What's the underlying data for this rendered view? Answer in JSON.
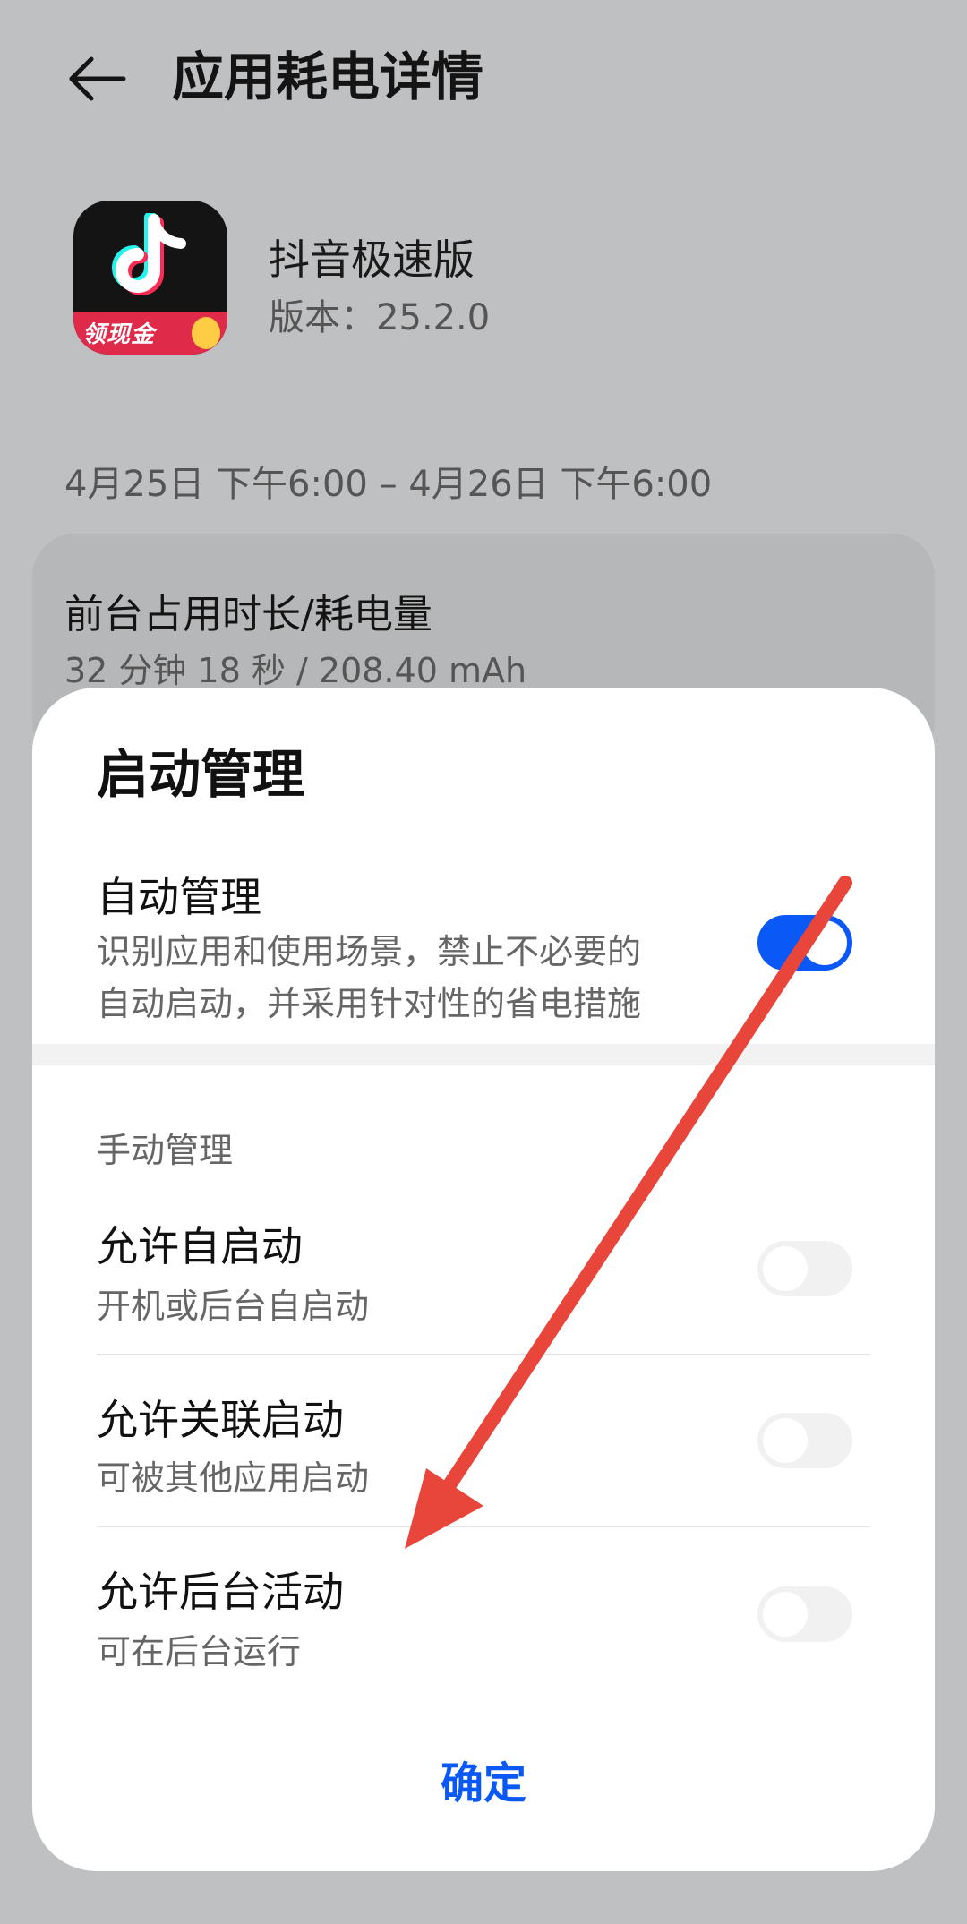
{
  "header": {
    "title": "应用耗电详情",
    "back_icon": "arrow-left-icon"
  },
  "app": {
    "name": "抖音极速版",
    "version": "版本：25.2.0",
    "icon_banner_text": "领现金",
    "icon_name": "douyin-lite-app-icon"
  },
  "date_range": "4月25日 下午6:00 – 4月26日 下午6:00",
  "usage": {
    "title": "前台占用时长/耗电量",
    "value": "32 分钟 18 秒 / 208.40 mAh"
  },
  "dialog": {
    "title": "启动管理",
    "auto_manage": {
      "title": "自动管理",
      "desc_line1": "识别应用和使用场景，禁止不必要的",
      "desc_line2": "自动启动，并采用针对性的省电措施",
      "enabled": true
    },
    "manual_section_label": "手动管理",
    "rows": [
      {
        "title": "允许自启动",
        "desc": "开机或后台自启动",
        "enabled": false
      },
      {
        "title": "允许关联启动",
        "desc": "可被其他应用启动",
        "enabled": false
      },
      {
        "title": "允许后台活动",
        "desc": "可在后台运行",
        "enabled": false
      }
    ],
    "confirm_label": "确定"
  },
  "colors": {
    "accent": "#0a59f7",
    "annotation_arrow": "#e8463a",
    "overlay_bg": "#bfc0c2"
  }
}
